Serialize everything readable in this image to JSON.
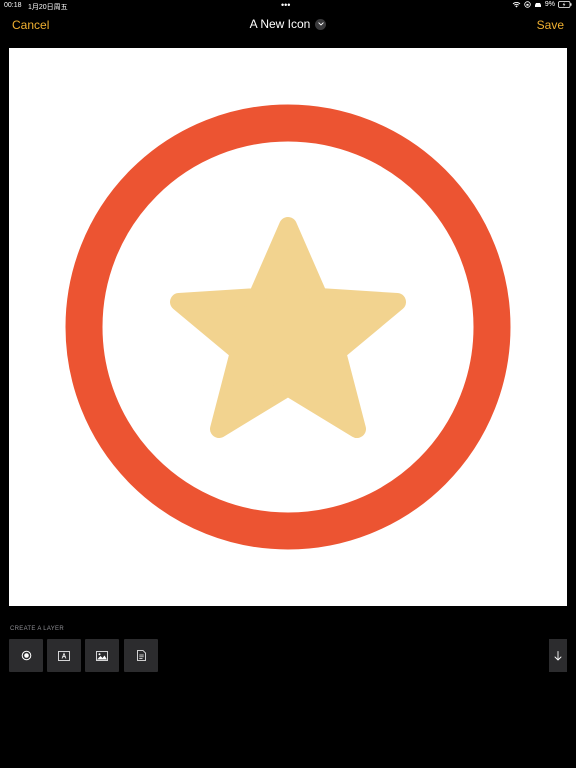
{
  "status_bar": {
    "time": "00:18",
    "date": "1月20日周五",
    "dots": "•••",
    "battery_pct": "9%"
  },
  "nav": {
    "cancel_label": "Cancel",
    "title": "A New Icon",
    "save_label": "Save"
  },
  "canvas": {
    "background": "#ffffff",
    "ring_color": "#ec5432",
    "star_color": "#f2d38f"
  },
  "layers": {
    "section_label": "CREATE A LAYER",
    "buttons": [
      {
        "icon": "shape-layer-icon"
      },
      {
        "icon": "text-layer-icon"
      },
      {
        "icon": "image-layer-icon"
      },
      {
        "icon": "document-layer-icon"
      }
    ],
    "scroll_icon": "arrow-down-icon"
  },
  "colors": {
    "accent": "#f0b030"
  }
}
